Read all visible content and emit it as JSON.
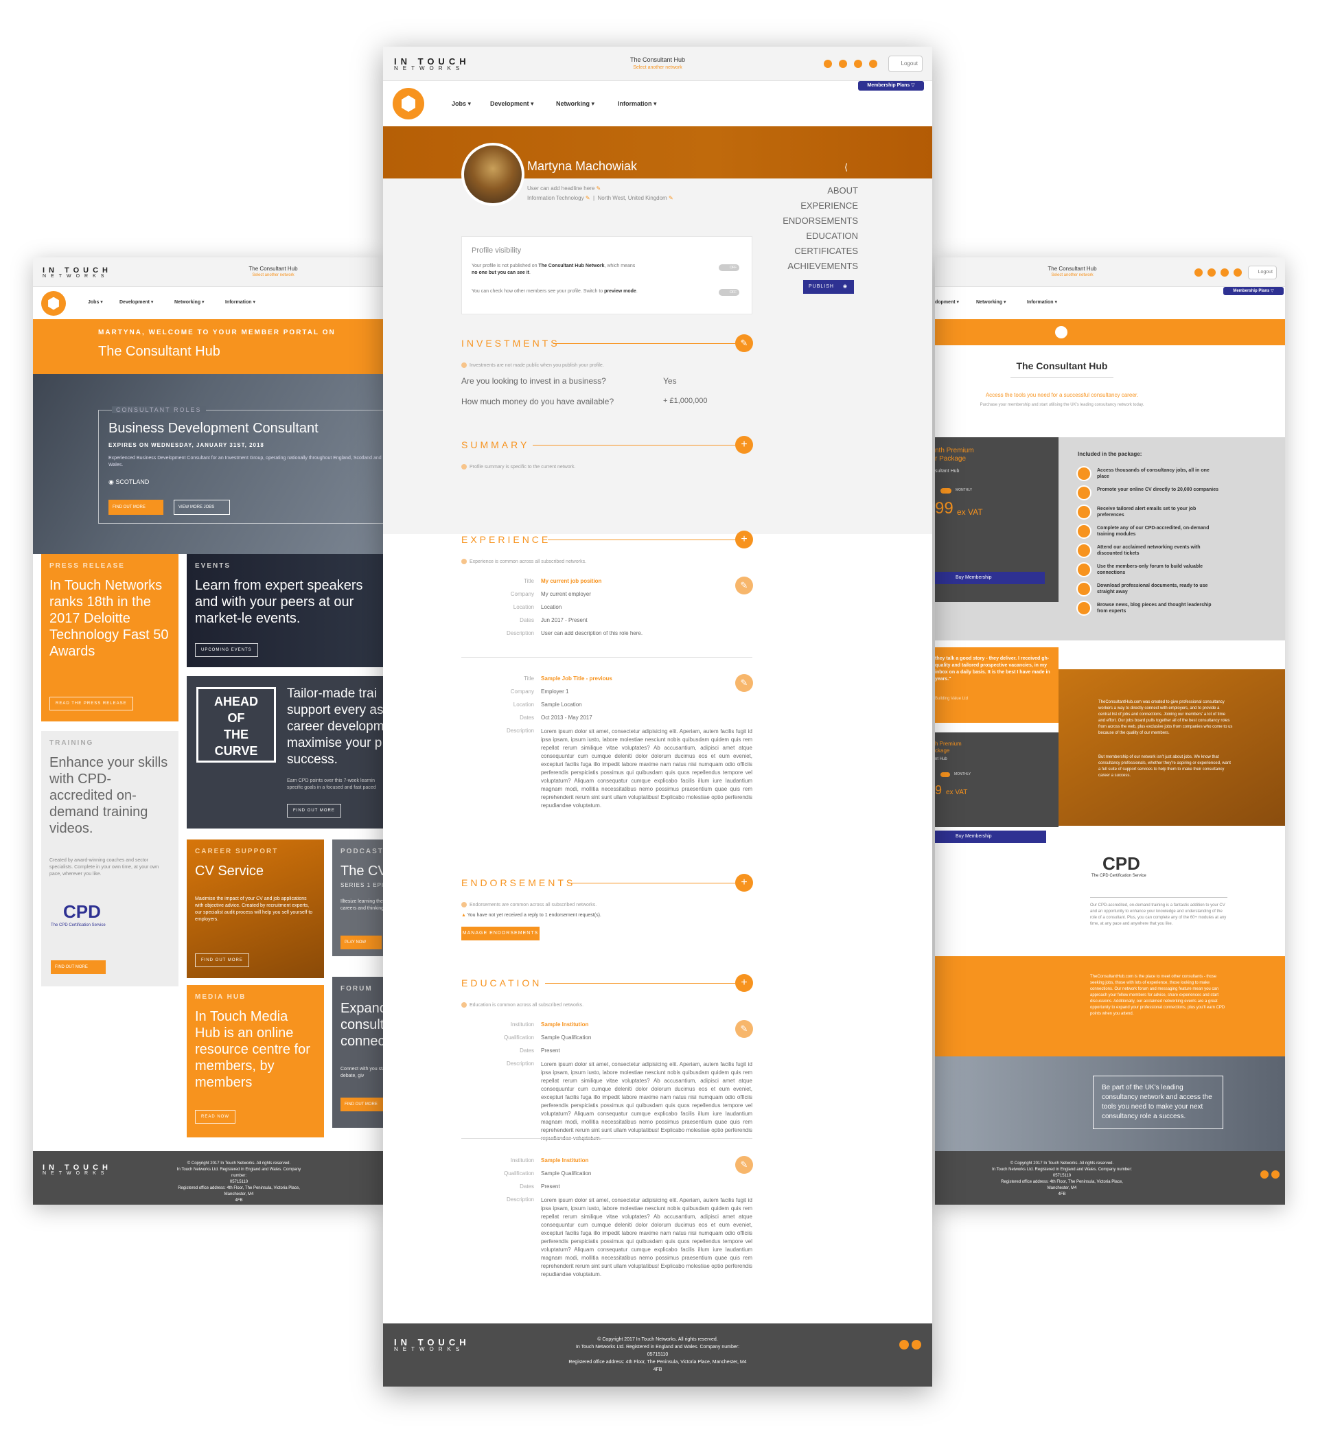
{
  "brand": {
    "word": "IN TOUCH",
    "sub": "NETWORKS"
  },
  "network": {
    "title": "The Consultant Hub",
    "select": "Select another network"
  },
  "nav": [
    "Jobs ▾",
    "Development ▾",
    "Networking ▾",
    "Information ▾"
  ],
  "nav_right": [
    "dopment ▾",
    "Networking ▾",
    "Information ▾"
  ],
  "logout": "Logout",
  "membership_plans": "Membership Plans",
  "left": {
    "welcome": "MARTYNA, WELCOME TO YOUR MEMBER PORTAL ON",
    "hub": "The Consultant Hub",
    "role": {
      "category": "CONSULTANT ROLES",
      "title": "Business Development Consultant",
      "expires": "EXPIRES ON WEDNESDAY, JANUARY 31ST, 2018",
      "desc": "Experienced Business Development Consultant for an Investment Group, operating nationally throughout England, Scotland and Wales.",
      "location": "SCOTLAND",
      "btn1": "FIND OUT MORE",
      "btn2": "VIEW MORE JOBS"
    },
    "press": {
      "category": "PRESS RELEASE",
      "head": "In Touch Networks ranks 18th in the 2017 Deloitte Technology Fast 50 Awards",
      "btn": "READ THE PRESS RELEASE"
    },
    "events": {
      "category": "EVENTS",
      "head": "Learn from expert speakers and with your peers at our market-le events.",
      "btn": "UPCOMING EVENTS"
    },
    "ahead": {
      "badge": [
        "AHEAD",
        "OF",
        "THE",
        "CURVE"
      ],
      "head": "Tailor-made trai support every as career developm maximise your p success.",
      "para": "Earn CPD points over this 7-week learnin specific goals in a focused and fast paced",
      "btn": "FIND OUT MORE"
    },
    "training": {
      "category": "TRAINING",
      "head": "Enhance your skills with CPD-accredited on-demand training videos.",
      "para": "Created by award-winning coaches and sector specialists. Complete in your own time, at your own pace, wherever you like.",
      "cpd": "CPD",
      "cpd_sub": "The CPD Certification Service",
      "btn": "FIND OUT MORE"
    },
    "cv": {
      "category": "CAREER SUPPORT",
      "head": "CV Service",
      "para": "Maximise the impact of your CV and job applications with objective advice. Created by recruitment experts, our specialist audit process will help you sell yourself to employers.",
      "btn": "FIND OUT MORE"
    },
    "podcast": {
      "category": "PODCASTS",
      "head": "The CV",
      "sub": "SERIES 1 EPI",
      "para": "Illtesize learning their careers and thinking",
      "btn": "PLAY NOW"
    },
    "media": {
      "category": "MEDIA HUB",
      "head": "In Touch Media Hub is an online resource centre for members, by members",
      "btn": "READ NOW"
    },
    "forum": {
      "category": "FORUM",
      "head": "Expanc consult connec",
      "para": "Connect with you start a debate, giv",
      "btn": "FIND OUT MORE"
    },
    "footer": [
      "© Copyright 2017 In Touch Networks. All rights reserved.",
      "In Touch Networks Ltd. Registered in England and Wales. Company number:",
      "05715110",
      "Registered office address: 4th Floor, The Peninsula, Victoria Place, Manchester, M4",
      "4FB"
    ]
  },
  "profile": {
    "name": "Martyna Machowiak",
    "headline": "User can add headline here",
    "industry": "Information Technology",
    "location": "North West, United Kingdom",
    "anchors": [
      "ABOUT",
      "EXPERIENCE",
      "ENDORSEMENTS",
      "EDUCATION",
      "CERTIFICATES",
      "ACHIEVEMENTS"
    ],
    "publish": "PUBLISH",
    "visibility": {
      "title": "Profile visibility",
      "line1": "Your profile is not published on ",
      "line1_bold": "The Consultant Hub Network",
      "line1_end": ", which means",
      "line2_bold": "no one but you can see it",
      "line3": "You can check how other members see your profile. Switch to ",
      "line3_bold": "preview mode",
      "toggle": "OFF"
    },
    "investments": {
      "title": "INVESTMENTS",
      "note": "Investments are not made public when you publish your profile.",
      "q1": "Are you looking to invest in a business?",
      "a1": "Yes",
      "q2": "How much money do you have available?",
      "a2": "+ £1,000,000"
    },
    "summary": {
      "title": "SUMMARY",
      "note": "Profile summary is specific to the current network."
    },
    "experience": {
      "title": "EXPERIENCE",
      "note": "Experience is common across all subscribed networks.",
      "labels": [
        "Title",
        "Company",
        "Location",
        "Dates",
        "Description"
      ],
      "job1": [
        "My current job position",
        "My current employer",
        "Location",
        "Jun 2017 - Present",
        "User can add description of this role here."
      ],
      "job2": [
        "Sample Job Title - previous",
        "Employer 1",
        "Sample Location",
        "Oct 2013 - May 2017"
      ]
    },
    "lorem": "Lorem ipsum dolor sit amet, consectetur adipisicing elit. Aperiam, autem facilis fugit id ipsa ipsam, ipsum iusto, labore molestiae nesciunt nobis quibusdam quidem quis rem repellat rerum similique vitae voluptates? Ab accusantium, adipisci amet atque consequuntur cum cumque deleniti dolor dolorum ducimus eos et eum eveniet, excepturi facilis fuga illo impedit labore maxime nam natus nisi numquam odio officiis perferendis perspiciatis possimus qui quibusdam quis quos repellendus tempore vel voluptatum? Aliquam consequatur cumque explicabo facilis illum iure laudantium magnam modi, mollitia necessitatibus nemo possimus praesentium quae quis rem reprehenderit rerum sint sunt ullam voluptatibus! Explicabo molestiae optio perferendis repudiandae voluptatum.",
    "endorsements": {
      "title": "ENDORSEMENTS",
      "note": "Endorsements are common across all subscribed networks.",
      "warn": "You have not yet received a reply to 1 endorsement request(s).",
      "btn": "MANAGE ENDORSEMENTS"
    },
    "education": {
      "title": "EDUCATION",
      "note": "Education is common across all subscribed networks.",
      "labels": [
        "Institution",
        "Qualification",
        "Dates",
        "Description"
      ],
      "values": [
        "Sample Institution",
        "Sample Qualification",
        "Present"
      ]
    },
    "footer": [
      "© Copyright 2017 In Touch Networks. All rights reserved.",
      "In Touch Networks Ltd. Registered in England and Wales. Company number:",
      "05715110",
      "Registered office address: 4th Floor, The Peninsula, Victoria Place, Manchester, M4",
      "4FB"
    ]
  },
  "right": {
    "title": "The Consultant Hub",
    "tagline": "Access the tools you need for a successful consultancy career.",
    "sub": "Purchase your membership and start utilising the UK's leading consultancy network today.",
    "package": {
      "title1": "nth Premium",
      "title2": "r Package",
      "name": "sultant Hub",
      "toggle": "MONTHLY",
      "price": "99",
      "vat": "ex VAT",
      "btn": "Buy Membership"
    },
    "included": "Included in the package:",
    "features": [
      "Access thousands of consultancy jobs, all in one place",
      "Promote your online CV directly to 20,000 companies",
      "Receive tailored alert emails set to your job preferences",
      "Complete any of our CPD-accredited, on-demand training modules",
      "Attend our acclaimed networking events with discounted tickets",
      "Use the members-only forum to build valuable connections",
      "Download professional documents, ready to use straight away",
      "Browse news, blog pieces and thought leadership from experts"
    ],
    "quote": "they talk a good story - they deliver. I received gh-quality and tailored prospective vacancies, in my inbox on a daily basis. It is the best I have made in years.\"",
    "quote_by": "Building Value Ltd",
    "about1": "TheConsultantHub.com was created to give professional consultancy workers a way to directly connect with employers, and to provide a central list of jobs and connections. Joining our members' a lot of time and effort. Our jobs board pulls together all of the best consultancy roles from across the web, plus exclusive jobs from companies who come to us because of the quality of our members.",
    "about2": "But membership of our network isn't just about jobs. We know that consultancy professionals, whether they're aspiring or experienced, want a full suite of support services to help them to make their consultancy career a success.",
    "package2": {
      "title1": "h Premium",
      "title2": "ckage",
      "name": "nt Hub",
      "toggle": "MONTHLY",
      "price": "9",
      "vat": "ex VAT",
      "btn": "Buy Membership"
    },
    "cpd": "CPD",
    "cpd_sub": "The CPD Certification Service",
    "cpd_text": "Our CPD-accredited, on-demand training is a fantastic addition to your CV and an opportunity to enhance your knowledge and understanding of the role of a consultant. Plus, you can complete any of the 60+ modules at any time, at any pace and anywhere that you like.",
    "forum_text": "TheConsultantHub.com is the place to meet other consultants - those seeking jobs, those with lots of experience, those looking to make connections. Our network forum and messaging feature mean you can approach your fellow members for advice, share experiences and start discussions. Additionally, our acclaimed networking events are a great opportunity to expand your professional connections, plus you'll earn CPD points when you attend.",
    "cta": "Be part of the UK's leading consultancy network and access the tools you need to make your next consultancy role a success.",
    "footer": [
      "© Copyright 2017 In Touch Networks. All rights reserved.",
      "In Touch Networks Ltd. Registered in England and Wales. Company number:",
      "05715110",
      "Registered office address: 4th Floor, The Peninsula, Victoria Place, Manchester, M4",
      "4FB"
    ]
  },
  "colors": {
    "orange": "#f7931e",
    "dark": "#4d4d4d",
    "navy": "#2e3192",
    "brown": "#b75f05"
  }
}
